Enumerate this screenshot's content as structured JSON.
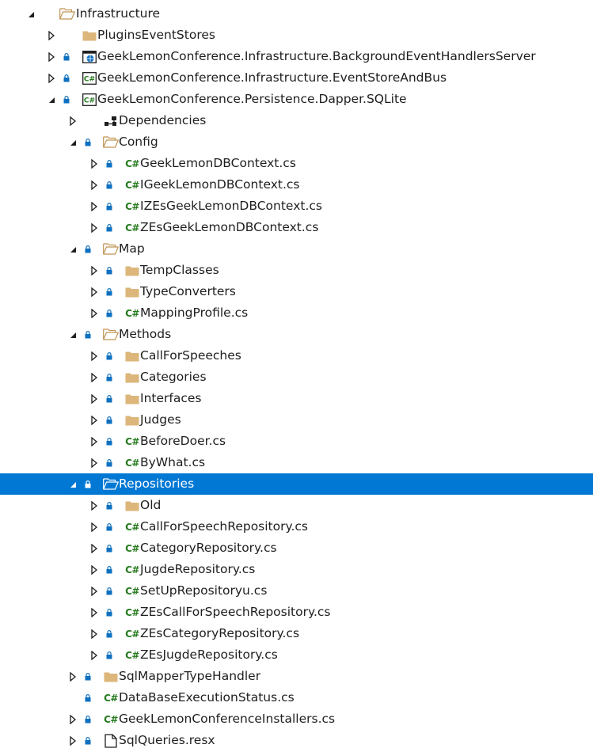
{
  "tree": [
    {
      "name": "tree-item-infrastructure",
      "depth": 0,
      "expander": "expanded",
      "lock": false,
      "icon": "folder-open-icon",
      "label": "Infrastructure"
    },
    {
      "name": "tree-item-pluginseventstores",
      "depth": 1,
      "expander": "collapsed",
      "lock": false,
      "icon": "folder-icon",
      "label": "PluginsEventStores"
    },
    {
      "name": "tree-item-backgroundeventhandlersserver",
      "depth": 1,
      "expander": "collapsed",
      "lock": true,
      "icon": "web-project-icon",
      "label": "GeekLemonConference.Infrastructure.BackgroundEventHandlersServer"
    },
    {
      "name": "tree-item-eventstoreandbus",
      "depth": 1,
      "expander": "collapsed",
      "lock": true,
      "icon": "csharp-project-icon",
      "label": "GeekLemonConference.Infrastructure.EventStoreAndBus"
    },
    {
      "name": "tree-item-persistence-dapper-sqlite",
      "depth": 1,
      "expander": "expanded",
      "lock": true,
      "icon": "csharp-project-icon",
      "label": "GeekLemonConference.Persistence.Dapper.SQLite"
    },
    {
      "name": "tree-item-dependencies",
      "depth": 2,
      "expander": "collapsed",
      "lock": false,
      "icon": "dependencies-icon",
      "label": "Dependencies"
    },
    {
      "name": "tree-item-config",
      "depth": 2,
      "expander": "expanded",
      "lock": true,
      "icon": "folder-open-icon",
      "label": "Config"
    },
    {
      "name": "tree-item-geeklemondbcontext",
      "depth": 3,
      "expander": "collapsed",
      "lock": true,
      "icon": "csharp-file-icon",
      "label": "GeekLemonDBContext.cs"
    },
    {
      "name": "tree-item-igeeklemondbcontext",
      "depth": 3,
      "expander": "collapsed",
      "lock": true,
      "icon": "csharp-file-icon",
      "label": "IGeekLemonDBContext.cs"
    },
    {
      "name": "tree-item-izesgeeklemondbcontext",
      "depth": 3,
      "expander": "collapsed",
      "lock": true,
      "icon": "csharp-file-icon",
      "label": "IZEsGeekLemonDBContext.cs"
    },
    {
      "name": "tree-item-zesgeeklemondbcontext",
      "depth": 3,
      "expander": "collapsed",
      "lock": true,
      "icon": "csharp-file-icon",
      "label": "ZEsGeekLemonDBContext.cs"
    },
    {
      "name": "tree-item-map",
      "depth": 2,
      "expander": "expanded",
      "lock": true,
      "icon": "folder-open-icon",
      "label": "Map"
    },
    {
      "name": "tree-item-tempclasses",
      "depth": 3,
      "expander": "collapsed",
      "lock": true,
      "icon": "folder-icon",
      "label": "TempClasses"
    },
    {
      "name": "tree-item-typeconverters",
      "depth": 3,
      "expander": "collapsed",
      "lock": true,
      "icon": "folder-icon",
      "label": "TypeConverters"
    },
    {
      "name": "tree-item-mappingprofile",
      "depth": 3,
      "expander": "collapsed",
      "lock": true,
      "icon": "csharp-file-icon",
      "label": "MappingProfile.cs"
    },
    {
      "name": "tree-item-methods",
      "depth": 2,
      "expander": "expanded",
      "lock": true,
      "icon": "folder-open-icon",
      "label": "Methods"
    },
    {
      "name": "tree-item-callforspeeches",
      "depth": 3,
      "expander": "collapsed",
      "lock": true,
      "icon": "folder-icon",
      "label": "CallForSpeeches"
    },
    {
      "name": "tree-item-categories",
      "depth": 3,
      "expander": "collapsed",
      "lock": true,
      "icon": "folder-icon",
      "label": "Categories"
    },
    {
      "name": "tree-item-interfaces",
      "depth": 3,
      "expander": "collapsed",
      "lock": true,
      "icon": "folder-icon",
      "label": "Interfaces"
    },
    {
      "name": "tree-item-judges",
      "depth": 3,
      "expander": "collapsed",
      "lock": true,
      "icon": "folder-icon",
      "label": "Judges"
    },
    {
      "name": "tree-item-beforedoer",
      "depth": 3,
      "expander": "collapsed",
      "lock": true,
      "icon": "csharp-file-icon",
      "label": "BeforeDoer.cs"
    },
    {
      "name": "tree-item-bywhat",
      "depth": 3,
      "expander": "collapsed",
      "lock": true,
      "icon": "csharp-file-icon",
      "label": "ByWhat.cs"
    },
    {
      "name": "tree-item-repositories",
      "depth": 2,
      "expander": "expanded",
      "lock": true,
      "icon": "folder-open-icon",
      "label": "Repositories",
      "selected": true
    },
    {
      "name": "tree-item-old",
      "depth": 3,
      "expander": "collapsed",
      "lock": true,
      "icon": "folder-icon",
      "label": "Old"
    },
    {
      "name": "tree-item-callforspeechrepository",
      "depth": 3,
      "expander": "collapsed",
      "lock": true,
      "icon": "csharp-file-icon",
      "label": "CallForSpeechRepository.cs"
    },
    {
      "name": "tree-item-categoryrepository",
      "depth": 3,
      "expander": "collapsed",
      "lock": true,
      "icon": "csharp-file-icon",
      "label": "CategoryRepository.cs"
    },
    {
      "name": "tree-item-jugderepository",
      "depth": 3,
      "expander": "collapsed",
      "lock": true,
      "icon": "csharp-file-icon",
      "label": "JugdeRepository.cs"
    },
    {
      "name": "tree-item-setuprepositoryu",
      "depth": 3,
      "expander": "collapsed",
      "lock": true,
      "icon": "csharp-file-icon",
      "label": "SetUpRepositoryu.cs"
    },
    {
      "name": "tree-item-zescallforspeechrepository",
      "depth": 3,
      "expander": "collapsed",
      "lock": true,
      "icon": "csharp-file-icon",
      "label": "ZEsCallForSpeechRepository.cs"
    },
    {
      "name": "tree-item-zescategoryrepository",
      "depth": 3,
      "expander": "collapsed",
      "lock": true,
      "icon": "csharp-file-icon",
      "label": "ZEsCategoryRepository.cs"
    },
    {
      "name": "tree-item-zesjugderepository",
      "depth": 3,
      "expander": "collapsed",
      "lock": true,
      "icon": "csharp-file-icon",
      "label": "ZEsJugdeRepository.cs"
    },
    {
      "name": "tree-item-sqlmappertypehandler",
      "depth": 2,
      "expander": "collapsed",
      "lock": true,
      "icon": "folder-icon",
      "label": "SqlMapperTypeHandler"
    },
    {
      "name": "tree-item-databaseexecutionstatus",
      "depth": 2,
      "expander": "none",
      "lock": true,
      "icon": "csharp-file-icon",
      "label": "DataBaseExecutionStatus.cs"
    },
    {
      "name": "tree-item-geeklemonconferenceinstallers",
      "depth": 2,
      "expander": "collapsed",
      "lock": true,
      "icon": "csharp-file-icon",
      "label": "GeekLemonConferenceInstallers.cs"
    },
    {
      "name": "tree-item-sqlqueries-resx",
      "depth": 2,
      "expander": "collapsed",
      "lock": true,
      "icon": "resx-file-icon",
      "label": "SqlQueries.resx"
    }
  ],
  "colors": {
    "selection_bg": "#0078d4",
    "folder": "#dcb67a",
    "csharp": "#247a1c",
    "lock": "#0e70c0",
    "text": "#1e1e1e"
  }
}
